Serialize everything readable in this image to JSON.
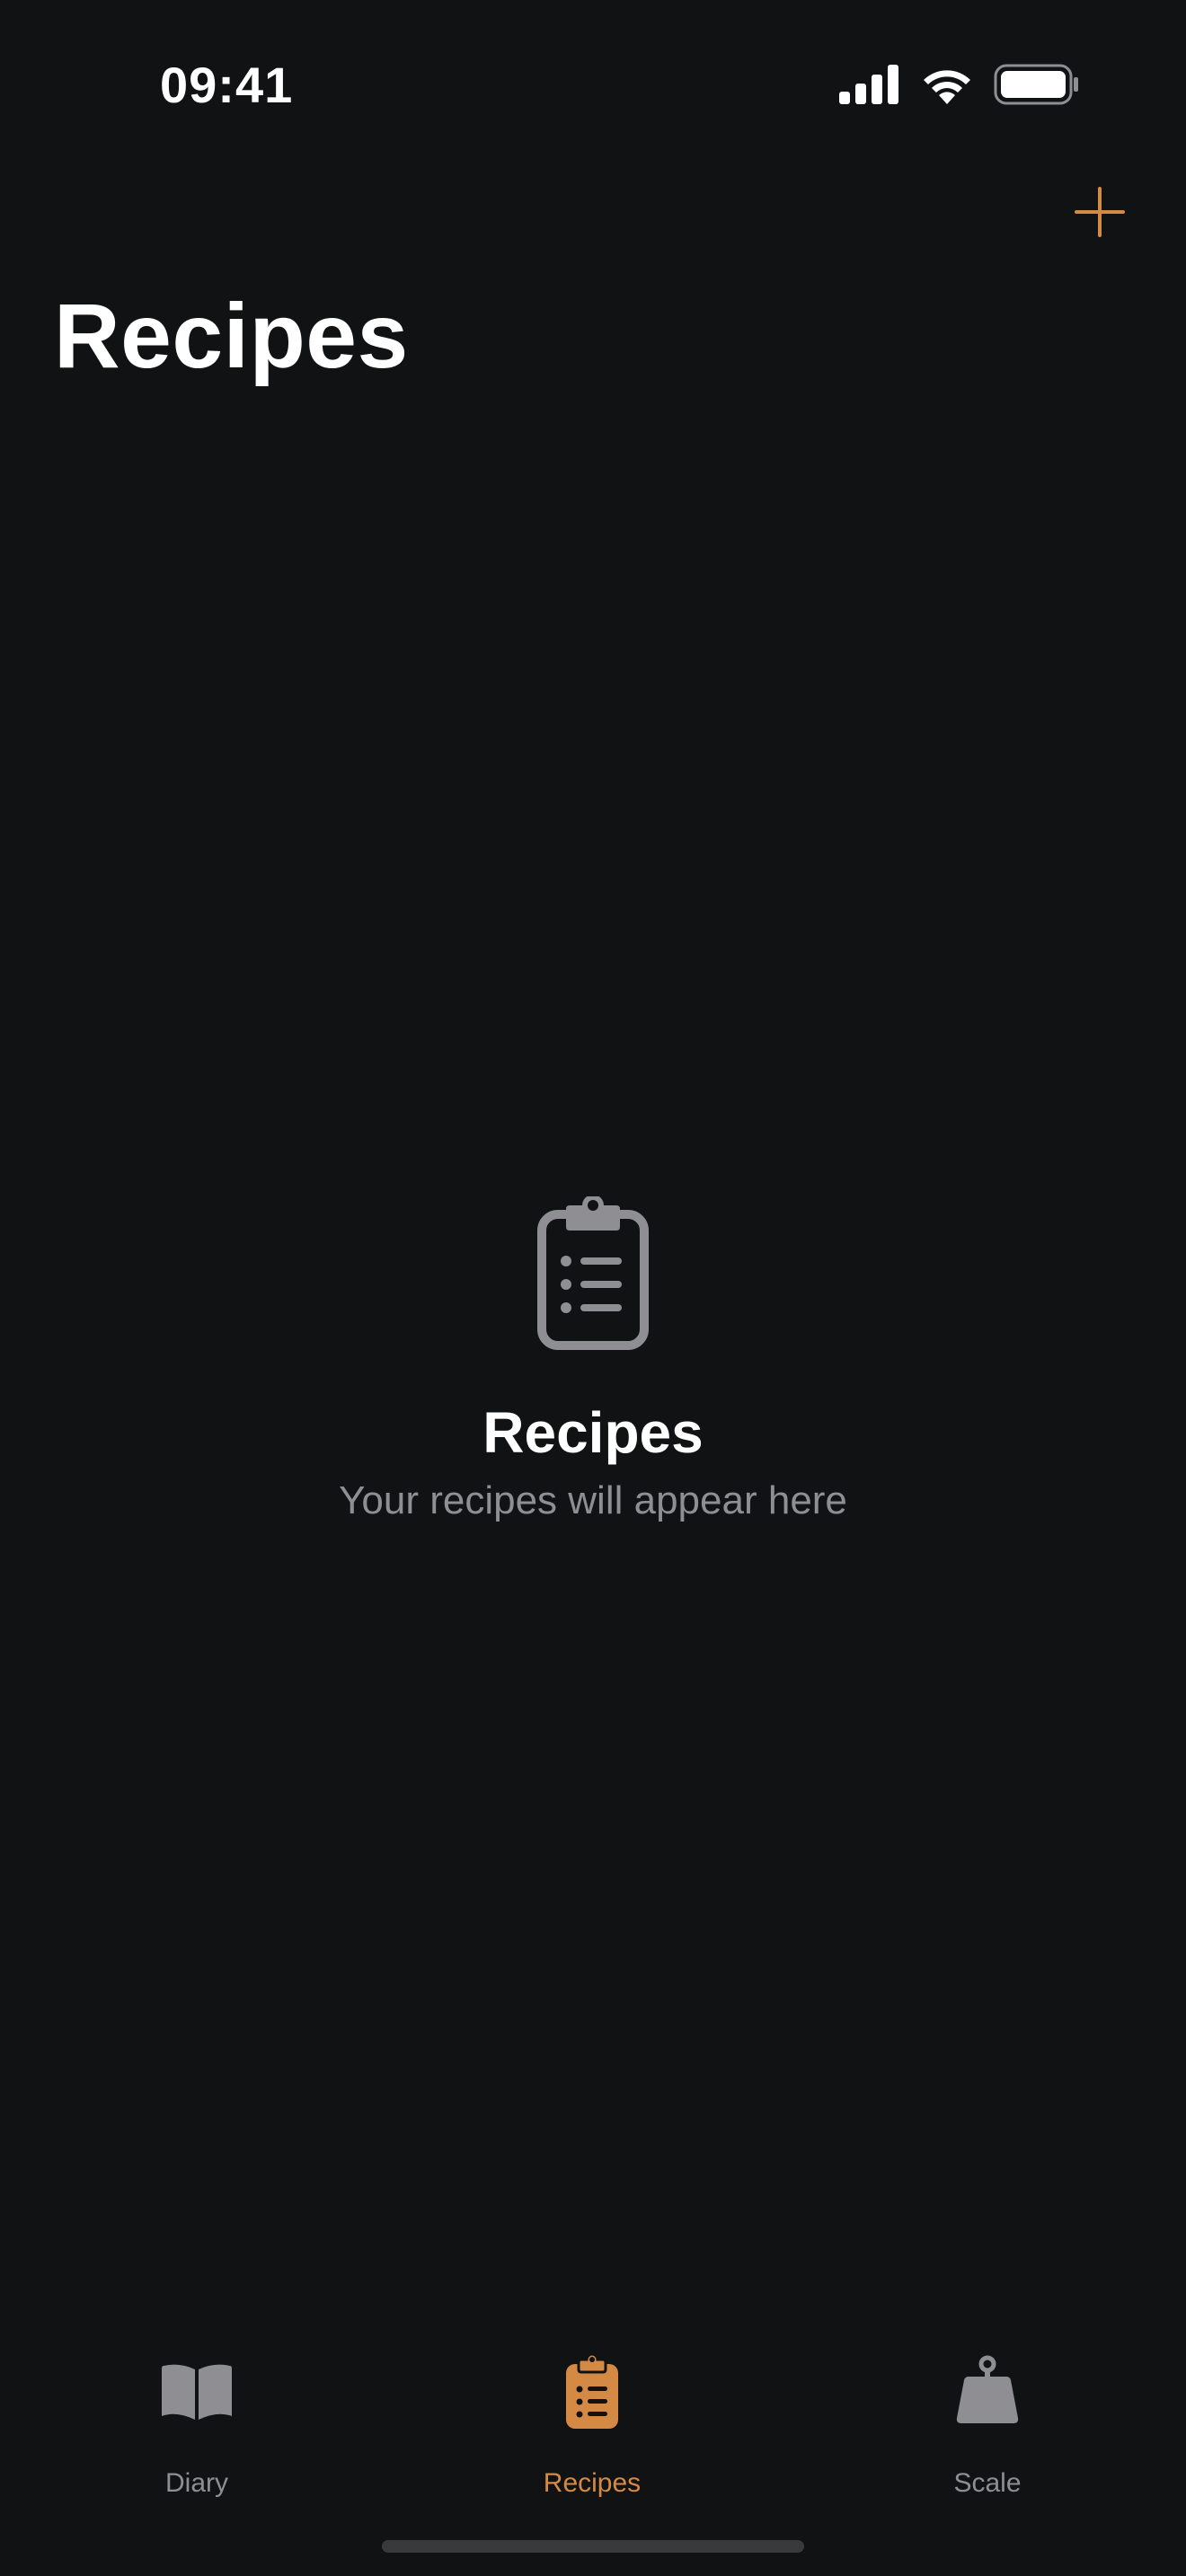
{
  "status_bar": {
    "time": "09:41",
    "icons": [
      "cellular-signal-icon",
      "wifi-icon",
      "battery-icon"
    ]
  },
  "nav": {
    "title": "Recipes",
    "add_icon": "plus-icon"
  },
  "empty_state": {
    "icon": "clipboard-list-icon",
    "title": "Recipes",
    "subtitle": "Your recipes will appear here"
  },
  "tabs": [
    {
      "label": "Diary",
      "icon": "book-icon",
      "active": false
    },
    {
      "label": "Recipes",
      "icon": "clipboard-list-icon",
      "active": true
    },
    {
      "label": "Scale",
      "icon": "weight-icon",
      "active": false
    }
  ],
  "colors": {
    "background": "#111214",
    "accent": "#d48a45",
    "secondary_text": "#8e8e93",
    "icon_gray": "#8e8e93"
  }
}
